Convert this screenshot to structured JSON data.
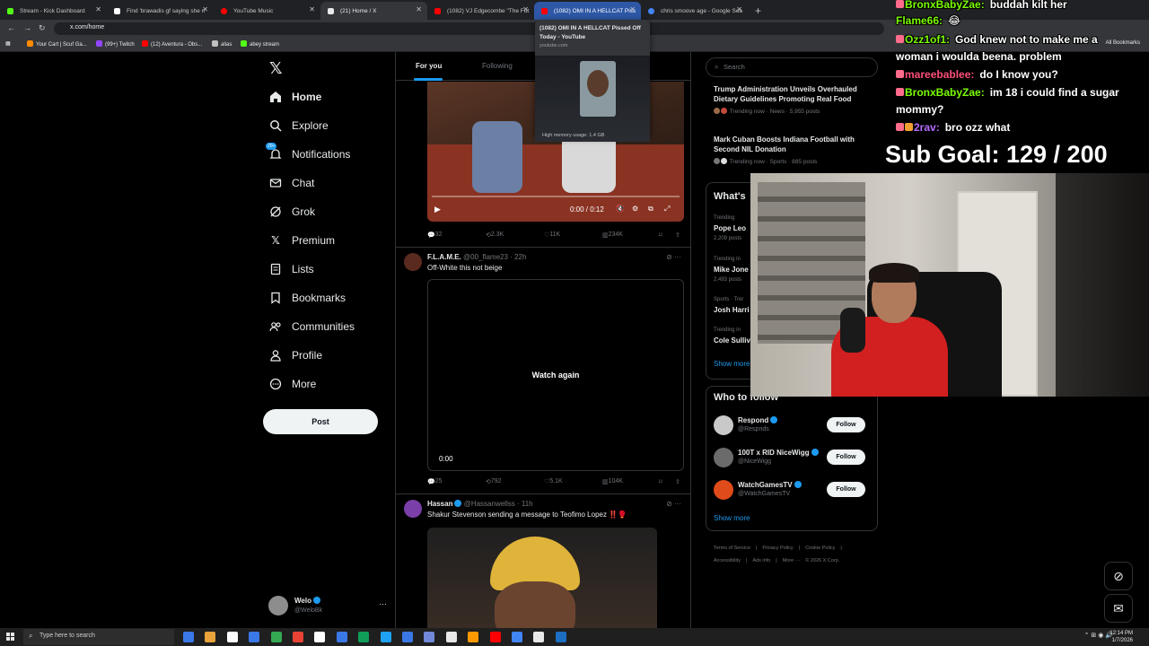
{
  "browser": {
    "tabs": [
      {
        "title": "Stream - Kick Dashboard",
        "fav": "#53fc18"
      },
      {
        "title": "Find 'brawadis gf saying she n",
        "fav": "#ffffff"
      },
      {
        "title": "YouTube Music",
        "fav": "#ff0000"
      },
      {
        "title": "(21) Home / X",
        "fav": "#e7e9ea"
      },
      {
        "title": "(1082) VJ Edgecombe \"The Fut",
        "fav": "#ff0000"
      },
      {
        "title": "(1082) OMI IN A HELLCAT Piss",
        "fav": "#ff0000"
      },
      {
        "title": "chris smoove age - Google Sea",
        "fav": "#4285f4"
      }
    ],
    "url": "x.com/home",
    "bookmarks": [
      {
        "label": "Your Cart | Scuf Ga...",
        "color": "#ff8a00"
      },
      {
        "label": "(99+) Twitch",
        "color": "#9146ff"
      },
      {
        "label": "(12) Aventura - Obs...",
        "color": "#ff0000"
      },
      {
        "label": "alias",
        "color": "#c0c0c0"
      },
      {
        "label": "abey stream",
        "color": "#53fc18"
      }
    ],
    "all_bookmarks": "All Bookmarks",
    "hover_card": {
      "title": "(1082) OMI IN A HELLCAT Pissed Off Today - YouTube",
      "host": "youtube.com",
      "memory": "High memory usage: 1.4 GB"
    }
  },
  "nav": {
    "items": [
      {
        "label": "Home",
        "icon": "home-icon"
      },
      {
        "label": "Explore",
        "icon": "search-icon"
      },
      {
        "label": "Notifications",
        "icon": "bell-icon"
      },
      {
        "label": "Chat",
        "icon": "mail-icon"
      },
      {
        "label": "Grok",
        "icon": "grok-icon"
      },
      {
        "label": "Premium",
        "icon": "x-icon"
      },
      {
        "label": "Lists",
        "icon": "list-icon"
      },
      {
        "label": "Bookmarks",
        "icon": "bookmark-icon"
      },
      {
        "label": "Communities",
        "icon": "people-icon"
      },
      {
        "label": "Profile",
        "icon": "person-icon"
      },
      {
        "label": "More",
        "icon": "more-circle-icon"
      }
    ],
    "notif_badge": "20+",
    "post_label": "Post",
    "account": {
      "name": "Welo",
      "handle": "@WeloBk"
    }
  },
  "timeline": {
    "tabs": [
      "For you",
      "Following"
    ],
    "tweet1": {
      "video_time": "0:00 / 0:12",
      "replies": "32",
      "reposts": "2.3K",
      "likes": "11K",
      "views": "234K"
    },
    "tweet2": {
      "name": "F.L.A.M.E.",
      "handle": "@00_flame23 · 22h",
      "text": "Off-White this not beige",
      "watch_again": "Watch again",
      "video_time": "0:00",
      "replies": "25",
      "reposts": "792",
      "likes": "5.1K",
      "views": "104K"
    },
    "tweet3": {
      "name": "Hassan",
      "handle": "@Hassanwellss · 11h",
      "text": "Shakur Stevenson sending a message to Teofimo Lopez ‼️🥊"
    }
  },
  "right": {
    "search_placeholder": "Search",
    "news": [
      {
        "title": "Trump Administration Unveils Overhauled Dietary Guidelines Promoting Real Food",
        "meta": "Trending now · News · 5,955 posts"
      },
      {
        "title": "Mark Cuban Boosts Indiana Football with Second NIL Donation",
        "meta": "Trending now · Sports · 885 posts"
      }
    ],
    "whats_happening": "What's",
    "trends": [
      {
        "cat": "Trending",
        "name": "Pope Leo",
        "posts": "2,209 posts"
      },
      {
        "cat": "Trending in",
        "name": "Mike Jone",
        "posts": "2,493 posts"
      },
      {
        "cat": "Sports · Trer",
        "name": "Josh Harri",
        "posts": ""
      },
      {
        "cat": "Trending in",
        "name": "Cole Sulliv",
        "posts": ""
      }
    ],
    "show_more": "Show more",
    "who_to_follow": "Who to follow",
    "follow_suggestions": [
      {
        "name": "Respond",
        "handle": "@Respnds",
        "color": "#c9c9c9"
      },
      {
        "name": "100T x RID NiceWigg",
        "handle": "@NiceWigg",
        "color": "#6b6b6b"
      },
      {
        "name": "WatchGamesTV",
        "handle": "@WatchGamesTV",
        "color": "#e04b1a"
      }
    ],
    "follow_label": "Follow",
    "show_more_2": "Show more",
    "footer": [
      "Terms of Service",
      "|",
      "Privacy Policy",
      "|",
      "Cookie Policy",
      "|",
      "Accessibility",
      "|",
      "Ads info",
      "|",
      "More ···",
      "© 2026 X Corp."
    ]
  },
  "overlay": {
    "chat": [
      {
        "user": "BronxBabyZae:",
        "msg": "buddah kilt her",
        "color": "#7CFC00",
        "badge": "#ff6b8b"
      },
      {
        "user": "Flame66:",
        "msg": "😂",
        "color": "#7CFC00",
        "badge": ""
      },
      {
        "user": "Ozz1of1:",
        "msg": "God knew not to make me a",
        "color": "#7CFC00",
        "badge": "#ff6b8b"
      },
      {
        "user": "",
        "msg": "woman i woulda beena. problem",
        "color": "#7CFC00",
        "badge": ""
      },
      {
        "user": "mareebablee:",
        "msg": "do I know you?",
        "color": "#ff4f7a",
        "badge": "#ff6b8b"
      },
      {
        "user": "BronxBabyZae:",
        "msg": "im 18 i could find a sugar",
        "color": "#7CFC00",
        "badge": "#ff6b8b"
      },
      {
        "user": "",
        "msg": "mommy?",
        "color": "#7CFC00",
        "badge": ""
      },
      {
        "user": "2rav:",
        "msg": "bro ozz what",
        "color": "#b56cff",
        "badge": "#ff6b8b"
      }
    ],
    "sub_goal": "Sub Goal:  129 / 200"
  },
  "taskbar": {
    "search_placeholder": "Type here to search",
    "apps": [
      "#3b78e7",
      "#e8a33a",
      "#ffffff",
      "#3b78e7",
      "#34a853",
      "#ea4335",
      "#ffffff",
      "#3b78e7",
      "#0f9d58",
      "#1da1f2",
      "#3b78e7",
      "#7289da",
      "#e8e8e8",
      "#ff9900",
      "#ff0000",
      "#4285f4",
      "#e8e8e8",
      "#1b6ec2"
    ],
    "time": "12:14 PM",
    "date": "1/7/2026"
  },
  "colors": {
    "accent": "#1d9bf0",
    "background": "#000000",
    "border": "#2f3336"
  }
}
